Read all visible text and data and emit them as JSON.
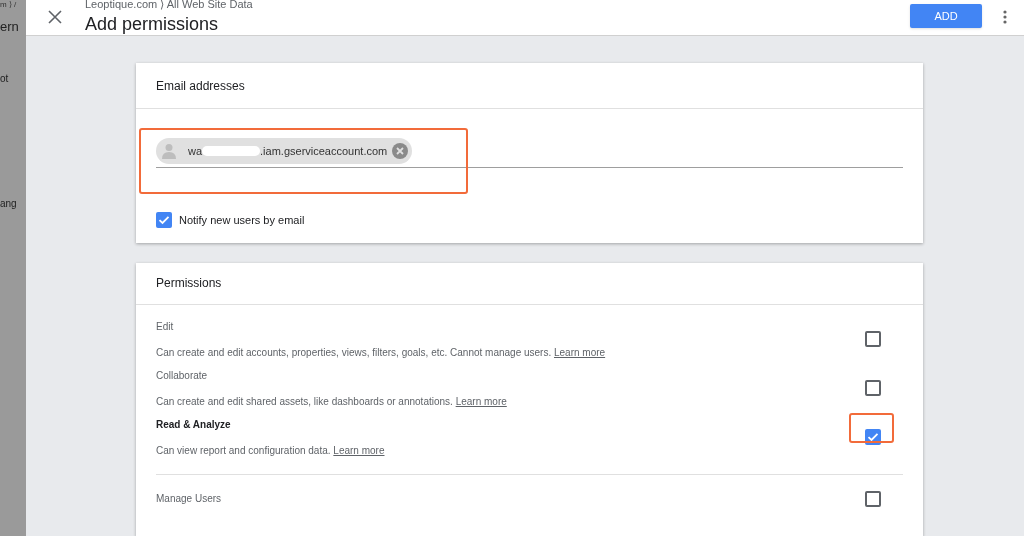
{
  "background_page": {
    "breadcrumb": "m ⟩ /",
    "title": "ern",
    "rows": [
      "ot",
      "ang"
    ]
  },
  "header": {
    "breadcrumb": "Leoptique.com ⟩ All Web Site Data",
    "title": "Add permissions",
    "add_button": "ADD"
  },
  "email_card": {
    "title": "Email addresses",
    "chip": {
      "text_start": "wa",
      "text_end": ".iam.gserviceaccount.com"
    },
    "notify": {
      "label": "Notify new users by email",
      "checked": true
    }
  },
  "permissions_card": {
    "title": "Permissions",
    "items": [
      {
        "name": "Edit",
        "description": "Can create and edit accounts, properties, views, filters, goals, etc. Cannot manage users.",
        "link": "Learn more",
        "checked": false,
        "highlighted": false
      },
      {
        "name": "Collaborate",
        "description": "Can create and edit shared assets, like dashboards or annotations.",
        "link": "Learn more",
        "checked": false,
        "highlighted": false
      },
      {
        "name": "Read & Analyze",
        "description": "Can view report and configuration data.",
        "link": "Learn more",
        "checked": true,
        "highlighted": true
      },
      {
        "name": "Manage Users",
        "checked": false,
        "highlighted": false
      }
    ]
  }
}
